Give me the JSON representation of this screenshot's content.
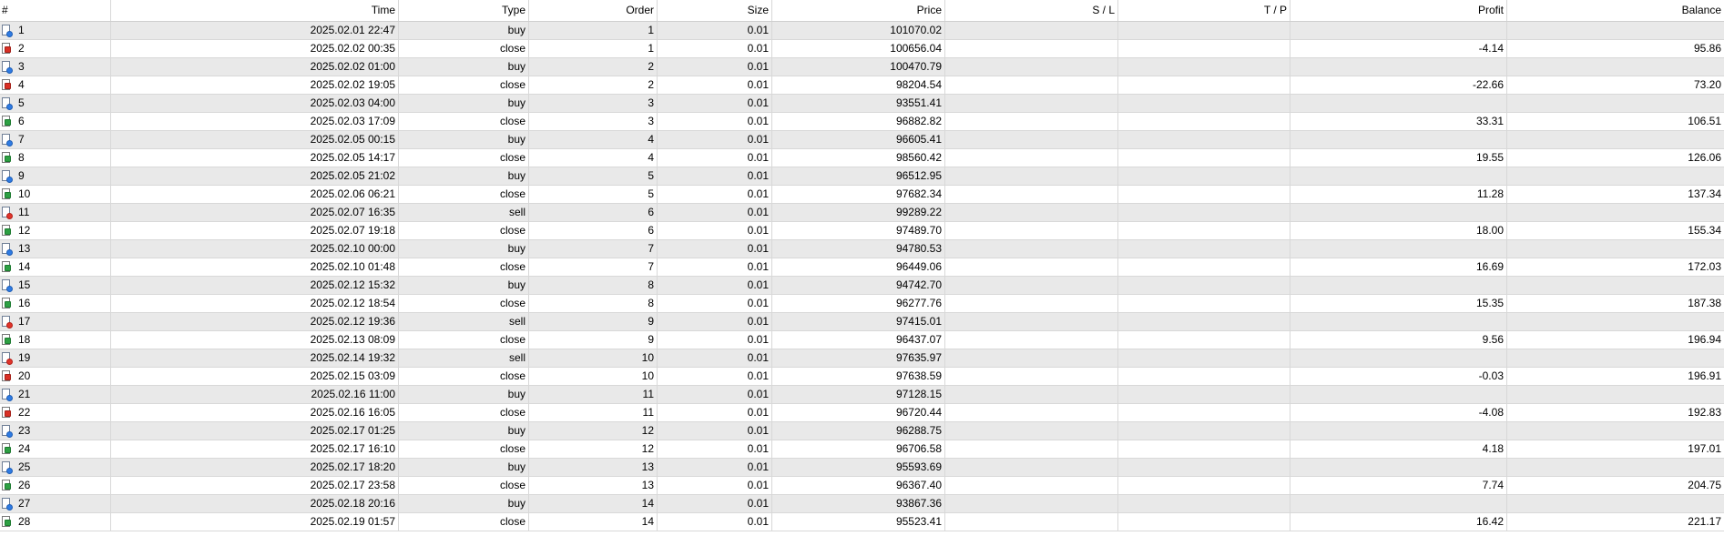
{
  "columns": [
    "#",
    "Time",
    "Type",
    "Order",
    "Size",
    "Price",
    "S / L",
    "T / P",
    "Profit",
    "Balance"
  ],
  "icons": {
    "buy": "deal-buy-icon",
    "sell": "deal-sell-icon",
    "close_win": "deal-close-profit-icon",
    "close_loss": "deal-close-loss-icon"
  },
  "colors": {
    "buy": "#2f7be3",
    "sell": "#e0342b",
    "profit": "#2ea043",
    "loss": "#d93025",
    "alt_row": "#e9e9e9"
  },
  "rows": [
    {
      "id": "1",
      "time": "2025.02.01 22:47",
      "type": "buy",
      "order": "1",
      "size": "0.01",
      "price": "101070.02",
      "sl": "",
      "tp": "",
      "profit": "",
      "balance": "",
      "icon": "buy"
    },
    {
      "id": "2",
      "time": "2025.02.02 00:35",
      "type": "close",
      "order": "1",
      "size": "0.01",
      "price": "100656.04",
      "sl": "",
      "tp": "",
      "profit": "-4.14",
      "balance": "95.86",
      "icon": "close_loss"
    },
    {
      "id": "3",
      "time": "2025.02.02 01:00",
      "type": "buy",
      "order": "2",
      "size": "0.01",
      "price": "100470.79",
      "sl": "",
      "tp": "",
      "profit": "",
      "balance": "",
      "icon": "buy"
    },
    {
      "id": "4",
      "time": "2025.02.02 19:05",
      "type": "close",
      "order": "2",
      "size": "0.01",
      "price": "98204.54",
      "sl": "",
      "tp": "",
      "profit": "-22.66",
      "balance": "73.20",
      "icon": "close_loss"
    },
    {
      "id": "5",
      "time": "2025.02.03 04:00",
      "type": "buy",
      "order": "3",
      "size": "0.01",
      "price": "93551.41",
      "sl": "",
      "tp": "",
      "profit": "",
      "balance": "",
      "icon": "buy"
    },
    {
      "id": "6",
      "time": "2025.02.03 17:09",
      "type": "close",
      "order": "3",
      "size": "0.01",
      "price": "96882.82",
      "sl": "",
      "tp": "",
      "profit": "33.31",
      "balance": "106.51",
      "icon": "close_win"
    },
    {
      "id": "7",
      "time": "2025.02.05 00:15",
      "type": "buy",
      "order": "4",
      "size": "0.01",
      "price": "96605.41",
      "sl": "",
      "tp": "",
      "profit": "",
      "balance": "",
      "icon": "buy"
    },
    {
      "id": "8",
      "time": "2025.02.05 14:17",
      "type": "close",
      "order": "4",
      "size": "0.01",
      "price": "98560.42",
      "sl": "",
      "tp": "",
      "profit": "19.55",
      "balance": "126.06",
      "icon": "close_win"
    },
    {
      "id": "9",
      "time": "2025.02.05 21:02",
      "type": "buy",
      "order": "5",
      "size": "0.01",
      "price": "96512.95",
      "sl": "",
      "tp": "",
      "profit": "",
      "balance": "",
      "icon": "buy"
    },
    {
      "id": "10",
      "time": "2025.02.06 06:21",
      "type": "close",
      "order": "5",
      "size": "0.01",
      "price": "97682.34",
      "sl": "",
      "tp": "",
      "profit": "11.28",
      "balance": "137.34",
      "icon": "close_win"
    },
    {
      "id": "11",
      "time": "2025.02.07 16:35",
      "type": "sell",
      "order": "6",
      "size": "0.01",
      "price": "99289.22",
      "sl": "",
      "tp": "",
      "profit": "",
      "balance": "",
      "icon": "sell"
    },
    {
      "id": "12",
      "time": "2025.02.07 19:18",
      "type": "close",
      "order": "6",
      "size": "0.01",
      "price": "97489.70",
      "sl": "",
      "tp": "",
      "profit": "18.00",
      "balance": "155.34",
      "icon": "close_win"
    },
    {
      "id": "13",
      "time": "2025.02.10 00:00",
      "type": "buy",
      "order": "7",
      "size": "0.01",
      "price": "94780.53",
      "sl": "",
      "tp": "",
      "profit": "",
      "balance": "",
      "icon": "buy"
    },
    {
      "id": "14",
      "time": "2025.02.10 01:48",
      "type": "close",
      "order": "7",
      "size": "0.01",
      "price": "96449.06",
      "sl": "",
      "tp": "",
      "profit": "16.69",
      "balance": "172.03",
      "icon": "close_win"
    },
    {
      "id": "15",
      "time": "2025.02.12 15:32",
      "type": "buy",
      "order": "8",
      "size": "0.01",
      "price": "94742.70",
      "sl": "",
      "tp": "",
      "profit": "",
      "balance": "",
      "icon": "buy"
    },
    {
      "id": "16",
      "time": "2025.02.12 18:54",
      "type": "close",
      "order": "8",
      "size": "0.01",
      "price": "96277.76",
      "sl": "",
      "tp": "",
      "profit": "15.35",
      "balance": "187.38",
      "icon": "close_win"
    },
    {
      "id": "17",
      "time": "2025.02.12 19:36",
      "type": "sell",
      "order": "9",
      "size": "0.01",
      "price": "97415.01",
      "sl": "",
      "tp": "",
      "profit": "",
      "balance": "",
      "icon": "sell"
    },
    {
      "id": "18",
      "time": "2025.02.13 08:09",
      "type": "close",
      "order": "9",
      "size": "0.01",
      "price": "96437.07",
      "sl": "",
      "tp": "",
      "profit": "9.56",
      "balance": "196.94",
      "icon": "close_win"
    },
    {
      "id": "19",
      "time": "2025.02.14 19:32",
      "type": "sell",
      "order": "10",
      "size": "0.01",
      "price": "97635.97",
      "sl": "",
      "tp": "",
      "profit": "",
      "balance": "",
      "icon": "sell"
    },
    {
      "id": "20",
      "time": "2025.02.15 03:09",
      "type": "close",
      "order": "10",
      "size": "0.01",
      "price": "97638.59",
      "sl": "",
      "tp": "",
      "profit": "-0.03",
      "balance": "196.91",
      "icon": "close_loss"
    },
    {
      "id": "21",
      "time": "2025.02.16 11:00",
      "type": "buy",
      "order": "11",
      "size": "0.01",
      "price": "97128.15",
      "sl": "",
      "tp": "",
      "profit": "",
      "balance": "",
      "icon": "buy"
    },
    {
      "id": "22",
      "time": "2025.02.16 16:05",
      "type": "close",
      "order": "11",
      "size": "0.01",
      "price": "96720.44",
      "sl": "",
      "tp": "",
      "profit": "-4.08",
      "balance": "192.83",
      "icon": "close_loss"
    },
    {
      "id": "23",
      "time": "2025.02.17 01:25",
      "type": "buy",
      "order": "12",
      "size": "0.01",
      "price": "96288.75",
      "sl": "",
      "tp": "",
      "profit": "",
      "balance": "",
      "icon": "buy"
    },
    {
      "id": "24",
      "time": "2025.02.17 16:10",
      "type": "close",
      "order": "12",
      "size": "0.01",
      "price": "96706.58",
      "sl": "",
      "tp": "",
      "profit": "4.18",
      "balance": "197.01",
      "icon": "close_win"
    },
    {
      "id": "25",
      "time": "2025.02.17 18:20",
      "type": "buy",
      "order": "13",
      "size": "0.01",
      "price": "95593.69",
      "sl": "",
      "tp": "",
      "profit": "",
      "balance": "",
      "icon": "buy"
    },
    {
      "id": "26",
      "time": "2025.02.17 23:58",
      "type": "close",
      "order": "13",
      "size": "0.01",
      "price": "96367.40",
      "sl": "",
      "tp": "",
      "profit": "7.74",
      "balance": "204.75",
      "icon": "close_win"
    },
    {
      "id": "27",
      "time": "2025.02.18 20:16",
      "type": "buy",
      "order": "14",
      "size": "0.01",
      "price": "93867.36",
      "sl": "",
      "tp": "",
      "profit": "",
      "balance": "",
      "icon": "buy"
    },
    {
      "id": "28",
      "time": "2025.02.19 01:57",
      "type": "close",
      "order": "14",
      "size": "0.01",
      "price": "95523.41",
      "sl": "",
      "tp": "",
      "profit": "16.42",
      "balance": "221.17",
      "icon": "close_win"
    }
  ]
}
